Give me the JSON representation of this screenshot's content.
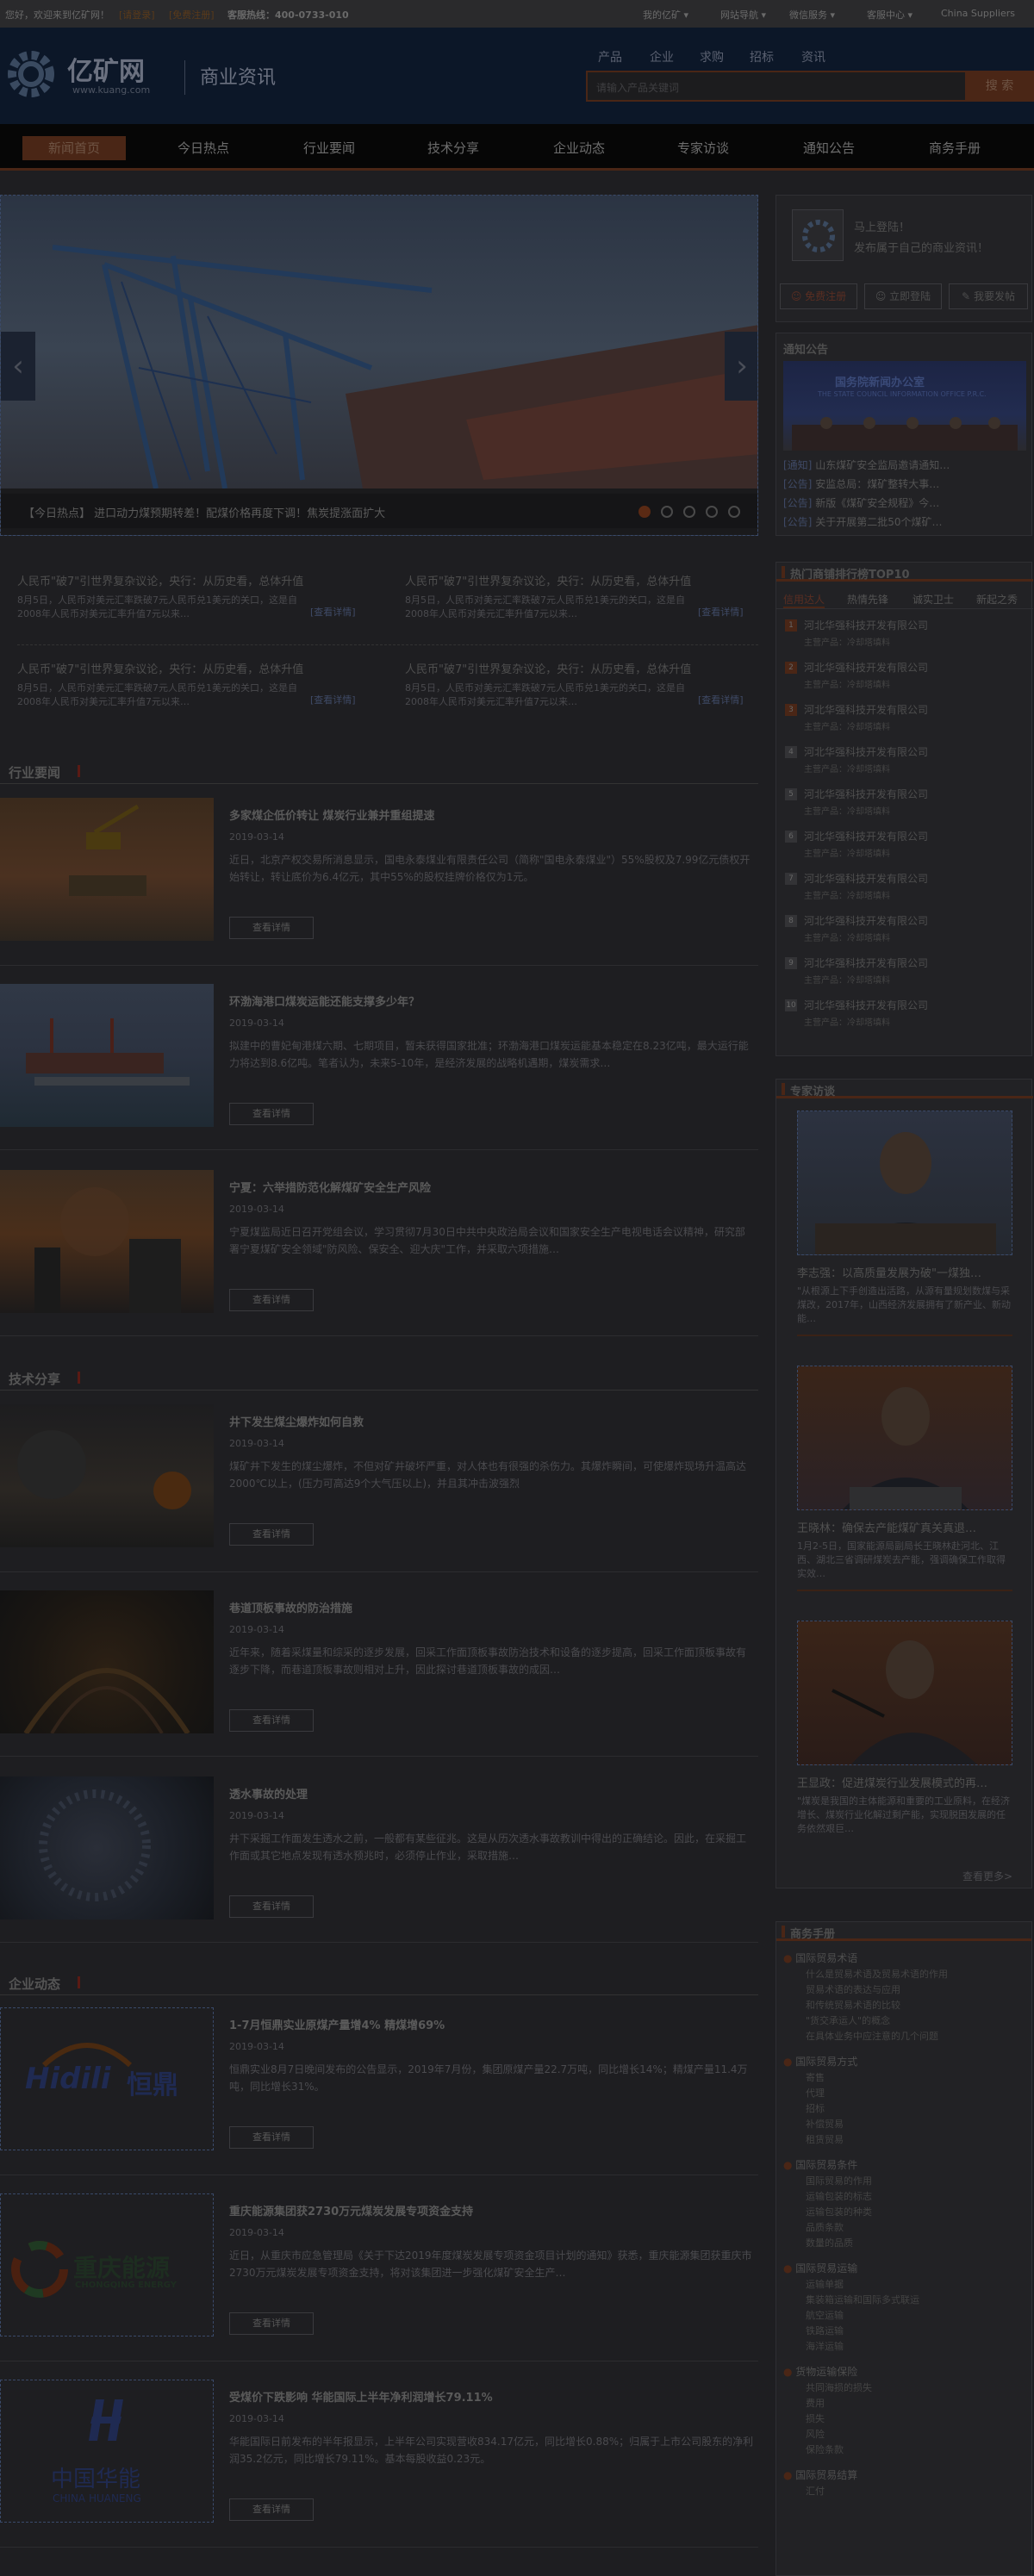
{
  "topbar": {
    "welcome": "您好，欢迎来到亿矿网！",
    "login": "[请登录]",
    "register": "[免费注册]",
    "hotline": "客服热线：400-0733-010",
    "menus": [
      "我的亿矿",
      "网站导航",
      "微信服务",
      "客服中心",
      "China Suppliers"
    ]
  },
  "header": {
    "logo_cn": "亿矿网",
    "logo_en": "www.kuang.com",
    "section": "商业资讯",
    "cats": [
      "产品",
      "企业",
      "求购",
      "招标",
      "资讯"
    ],
    "search_placeholder": "请输入产品关键词",
    "search_btn": "搜 索"
  },
  "nav": {
    "items": [
      "新闻首页",
      "今日热点",
      "行业要闻",
      "技术分享",
      "企业动态",
      "专家访谈",
      "通知公告",
      "商务手册"
    ]
  },
  "banner": {
    "caption": "【今日热点】  进口动力煤预期转差！配煤价格再度下调！焦炭提涨面扩大"
  },
  "headlines": [
    {
      "title": "人民币\"破7\"引世界复杂议论，央行：从历史看，总体升值",
      "desc": "8月5日，人民币对美元汇率跌破7元人民币兑1美元的关口，这是自2008年人民币对美元汇率升值7元以来…",
      "more": "[查看详情]"
    },
    {
      "title": "人民币\"破7\"引世界复杂议论，央行：从历史看，总体升值",
      "desc": "8月5日，人民币对美元汇率跌破7元人民币兑1美元的关口，这是自2008年人民币对美元汇率升值7元以来…",
      "more": "[查看详情]"
    },
    {
      "title": "人民币\"破7\"引世界复杂议论，央行：从历史看，总体升值",
      "desc": "8月5日，人民币对美元汇率跌破7元人民币兑1美元的关口，这是自2008年人民币对美元汇率升值7元以来…",
      "more": "[查看详情]"
    },
    {
      "title": "人民币\"破7\"引世界复杂议论，央行：从历史看，总体升值",
      "desc": "8月5日，人民币对美元汇率跌破7元人民币兑1美元的关口，这是自2008年人民币对美元汇率升值7元以来…",
      "more": "[查看详情]"
    }
  ],
  "sections": [
    {
      "title": "行业要闻",
      "articles": [
        {
          "title": "多家煤企低价转让 煤炭行业兼并重组提速",
          "date": "2019-03-14",
          "desc": "近日，北京产权交易所消息显示，国电永泰煤业有限责任公司（简称\"国电永泰煤业\"）55%股权及7.99亿元债权开始转让，转让底价为6.4亿元，其中55%的股权挂牌价格仅为1元。",
          "btn": "查看详情"
        },
        {
          "title": "环渤海港口煤炭运能还能支撑多少年？",
          "date": "2019-03-14",
          "desc": "拟建中的曹妃甸港煤六期、七期项目，暂未获得国家批准；环渤海港口煤炭运能基本稳定在8.23亿吨，最大运行能力将达到8.6亿吨。笔者认为，未来5-10年，是经济发展的战略机遇期，煤炭需求…",
          "btn": "查看详情"
        },
        {
          "title": "宁夏：六举措防范化解煤矿安全生产风险",
          "date": "2019-03-14",
          "desc": "宁夏煤监局近日召开党组会议，学习贯彻7月30日中共中央政治局会议和国家安全生产电视电话会议精神，研究部署宁夏煤矿安全领域\"防风险、保安全、迎大庆\"工作，并采取六项措施…",
          "btn": "查看详情"
        }
      ]
    },
    {
      "title": "技术分享",
      "articles": [
        {
          "title": "井下发生煤尘爆炸如何自救",
          "date": "2019-03-14",
          "desc": "煤矿井下发生的煤尘爆炸，不但对矿井破坏严重，对人体也有很强的杀伤力。其爆炸瞬间，可使爆炸现场升温高达2000℃以上，(压力可高达9个大气压以上)，并且其冲击波强烈",
          "btn": "查看详情"
        },
        {
          "title": "巷道顶板事故的防治措施",
          "date": "2019-03-14",
          "desc": "近年来，随着采煤量和综采的逐步发展，回采工作面顶板事故防治技术和设备的逐步提高，回采工作面顶板事故有逐步下降，而巷道顶板事故则相对上升，因此探讨巷道顶板事故的成因…",
          "btn": "查看详情"
        },
        {
          "title": "透水事故的处理",
          "date": "2019-03-14",
          "desc": "井下采掘工作面发生透水之前，一般都有某些征兆。这是从历次透水事故教训中得出的正确结论。因此，在采掘工作面或其它地点发现有透水预兆时，必须停止作业，采取措施…",
          "btn": "查看详情"
        }
      ]
    },
    {
      "title": "企业动态",
      "articles": [
        {
          "title": "1-7月恒鼎实业原煤产量增4% 精煤增69%",
          "date": "2019-03-14",
          "desc": "恒鼎实业8月7日晚间发布的公告显示，2019年7月份，集团原煤产量22.7万吨，同比增长14%；精煤产量11.4万吨，同比增长31%。",
          "btn": "查看详情"
        },
        {
          "title": "重庆能源集团获2730万元煤炭发展专项资金支持",
          "date": "2019-03-14",
          "desc": "近日，从重庆市应急管理局《关于下达2019年度煤炭发展专项资金项目计划的通知》获悉，重庆能源集团获重庆市2730万元煤炭发展专项资金支持，将对该集团进一步强化煤矿安全生产…",
          "btn": "查看详情"
        },
        {
          "title": "受煤价下跌影响 华能国际上半年净利润增长79.11%",
          "date": "2019-03-14",
          "desc": "华能国际日前发布的半年报显示，上半年公司实现营收834.17亿元，同比增长0.88%；归属于上市公司股东的净利润35.2亿元，同比增长79.11%。基本每股收益0.23元。",
          "btn": "查看详情"
        }
      ]
    }
  ],
  "logos": {
    "hidili_en": "Hidili",
    "hidili_cn": "恒鼎",
    "cq_cn": "重庆能源",
    "cq_en": "CHONGQING ENERGY",
    "hn_cn": "中国华能",
    "hn_en": "CHINA HUANENG"
  },
  "sidebar": {
    "login_box": {
      "text1": "马上登陆！",
      "text2": "发布属于自己的商业资讯！",
      "btns": [
        "免费注册",
        "立即登陆",
        "我要发帖"
      ]
    },
    "notice": {
      "title": "通知公告",
      "img_text1": "国务院新闻办公室",
      "img_text2": "THE STATE COUNCIL INFORMATION OFFICE P.R.C.",
      "items": [
        {
          "tag": "[通知]",
          "text": "山东煤矿安全监局邀请通知…"
        },
        {
          "tag": "[公告]",
          "text": "安监总局：煤矿整转大事…"
        },
        {
          "tag": "[公告]",
          "text": "新版《煤矿安全规程》今…"
        },
        {
          "tag": "[公告]",
          "text": "关于开展第二批50个煤矿…"
        }
      ]
    },
    "ranking": {
      "title": "热门商铺排行榜TOP10",
      "tabs": [
        "信用达人",
        "热情先锋",
        "诚实卫士",
        "新起之秀"
      ],
      "items": [
        {
          "rank": "1",
          "name": "河北华强科技开发有限公司",
          "sub": "主营产品：冷却塔填料"
        },
        {
          "rank": "2",
          "name": "河北华强科技开发有限公司",
          "sub": "主营产品：冷却塔填料"
        },
        {
          "rank": "3",
          "name": "河北华强科技开发有限公司",
          "sub": "主营产品：冷却塔填料"
        },
        {
          "rank": "4",
          "name": "河北华强科技开发有限公司",
          "sub": "主营产品：冷却塔填料"
        },
        {
          "rank": "5",
          "name": "河北华强科技开发有限公司",
          "sub": "主营产品：冷却塔填料"
        },
        {
          "rank": "6",
          "name": "河北华强科技开发有限公司",
          "sub": "主营产品：冷却塔填料"
        },
        {
          "rank": "7",
          "name": "河北华强科技开发有限公司",
          "sub": "主营产品：冷却塔填料"
        },
        {
          "rank": "8",
          "name": "河北华强科技开发有限公司",
          "sub": "主营产品：冷却塔填料"
        },
        {
          "rank": "9",
          "name": "河北华强科技开发有限公司",
          "sub": "主营产品：冷却塔填料"
        },
        {
          "rank": "10",
          "name": "河北华强科技开发有限公司",
          "sub": "主营产品：冷却塔填料"
        }
      ]
    },
    "experts": {
      "title": "专家访谈",
      "items": [
        {
          "title": "李志强：以高质量发展为破\"一煤独…",
          "desc": "\"从根源上下手创造出活路，从源有量规划数煤与采煤改，2017年，山西经济发展拥有了新产业、新动能…"
        },
        {
          "title": "王晓林：确保去产能煤矿真关真退…",
          "desc": "1月2-5日，国家能源局副局长王晓林赴河北、江西、湖北三省调研煤炭去产能，强调确保工作取得实效…"
        },
        {
          "title": "王显政：促进煤炭行业发展模式的再…",
          "desc": "\"煤炭是我国的主体能源和重要的工业原料，在经济增长、煤炭行业化解过剩产能，实现脱困发展的任务依然艰巨…"
        }
      ],
      "more": "查看更多>"
    },
    "handbook": {
      "title": "商务手册",
      "groups": [
        {
          "head": "国际贸易术语",
          "items": [
            "什么是贸易术语及贸易术语的作用",
            "贸易术语的表达与应用",
            "和传统贸易术语的比较",
            "\"货交承运人\"的概念",
            "在具体业务中应注意的几个问题"
          ]
        },
        {
          "head": "国际贸易方式",
          "items": [
            "寄售",
            "代理",
            "招标",
            "补偿贸易",
            "租赁贸易"
          ]
        },
        {
          "head": "国际贸易条件",
          "items": [
            "国际贸易的作用",
            "运输包装的标志",
            "运输包装的种类",
            "品质条款",
            "数量的品质"
          ]
        },
        {
          "head": "国际贸易运输",
          "items": [
            "运输单据",
            "集装箱运输和国际多式联运",
            "航空运输",
            "铁路运输",
            "海洋运输"
          ]
        },
        {
          "head": "货物运输保险",
          "items": [
            "共同海损的损失",
            "费用",
            "损失",
            "风险",
            "保险条款"
          ]
        },
        {
          "head": "国际贸易结算",
          "items": [
            "汇付"
          ]
        }
      ]
    }
  }
}
